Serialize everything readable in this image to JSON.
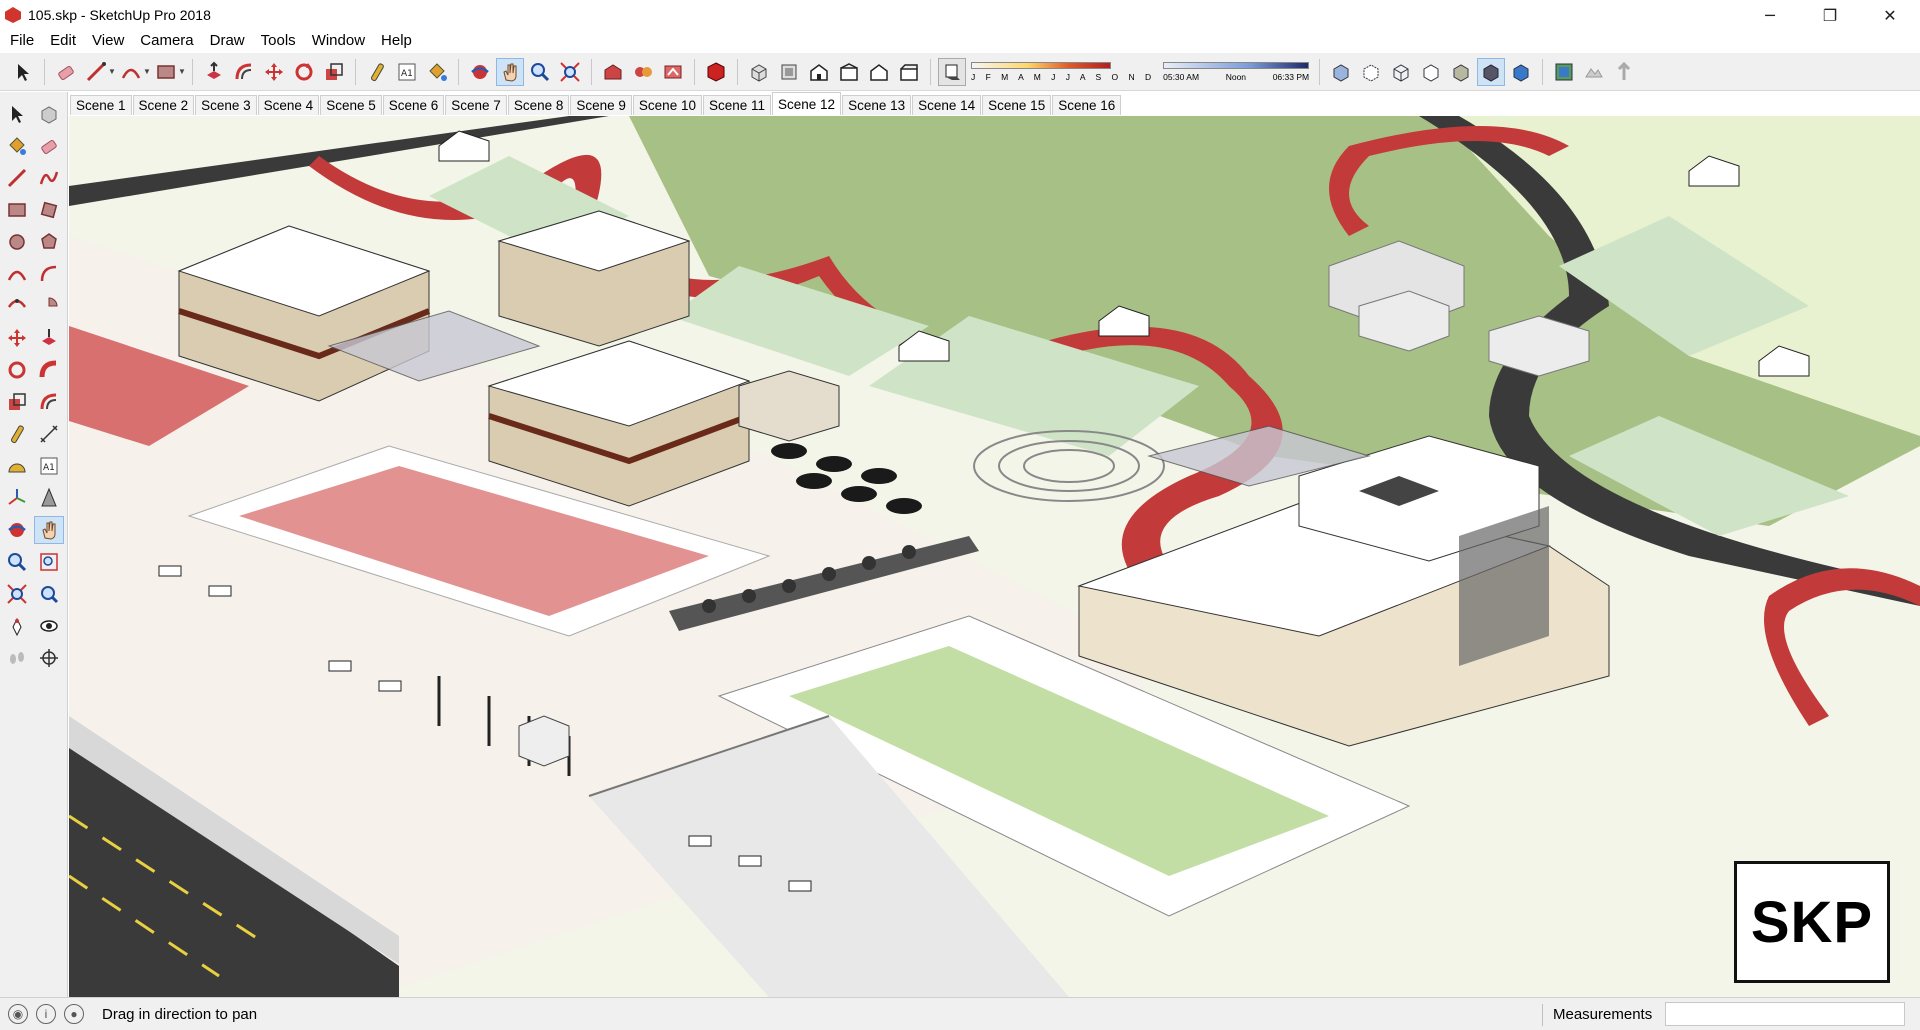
{
  "window": {
    "title": "105.skp - SketchUp Pro 2018",
    "controls": {
      "minimize": "─",
      "maximize": "❐",
      "close": "✕"
    }
  },
  "menu": [
    "File",
    "Edit",
    "View",
    "Camera",
    "Draw",
    "Tools",
    "Window",
    "Help"
  ],
  "toolbar": {
    "shadow_months": "J F M A M J J A S O N D",
    "shadow_times": [
      "05:30 AM",
      "Noon",
      "06:33 PM"
    ]
  },
  "scenes": {
    "tabs": [
      "Scene 1",
      "Scene 2",
      "Scene 3",
      "Scene 4",
      "Scene 5",
      "Scene 6",
      "Scene 7",
      "Scene 8",
      "Scene 9",
      "Scene 10",
      "Scene 11",
      "Scene 12",
      "Scene 13",
      "Scene 14",
      "Scene 15",
      "Scene 16"
    ],
    "active": "Scene 12"
  },
  "viewport": {
    "badge": "SKP"
  },
  "status": {
    "message": "Drag in direction to pan",
    "measurements_label": "Measurements",
    "measurements_value": ""
  },
  "colors": {
    "accent_red": "#c33a3a",
    "grass_light": "#e9f2d0",
    "grass_dark": "#a9c28a",
    "road": "#3a3a3a",
    "green_tiles": "#8fc35a"
  }
}
